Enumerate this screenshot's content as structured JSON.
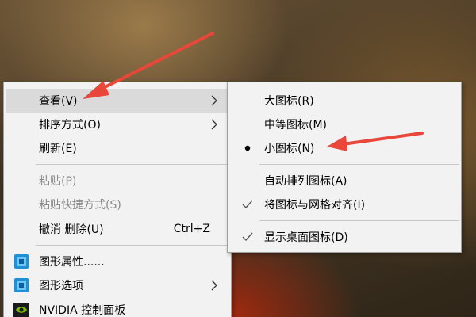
{
  "context_menu": {
    "items": [
      {
        "label": "查看(V)"
      },
      {
        "label": "排序方式(O)"
      },
      {
        "label": "刷新(E)"
      },
      {
        "label": "粘贴(P)"
      },
      {
        "label": "粘贴快捷方式(S)"
      },
      {
        "label": "撤消 删除(U)",
        "shortcut": "Ctrl+Z"
      },
      {
        "label": "图形属性......"
      },
      {
        "label": "图形选项"
      },
      {
        "label": "NVIDIA 控制面板"
      }
    ]
  },
  "view_submenu": {
    "items": [
      {
        "label": "大图标(R)"
      },
      {
        "label": "中等图标(M)"
      },
      {
        "label": "小图标(N)",
        "selected": true
      },
      {
        "label": "自动排列图标(A)"
      },
      {
        "label": "将图标与网格对齐(I)",
        "checked": true
      },
      {
        "label": "显示桌面图标(D)",
        "checked": true
      }
    ]
  },
  "colors": {
    "annotation_arrow": "#e8473a",
    "menu_background": "#f2f2f2",
    "highlight": "#dadada",
    "disabled_text": "#8a8a8a"
  },
  "icons": {
    "arrow": "submenu-arrow-icon",
    "graphics_properties": "intel-graphics-icon",
    "graphics_options": "intel-graphics-icon",
    "nvidia": "nvidia-icon",
    "selected": "radio-dot-icon",
    "checked": "checkmark-icon"
  }
}
